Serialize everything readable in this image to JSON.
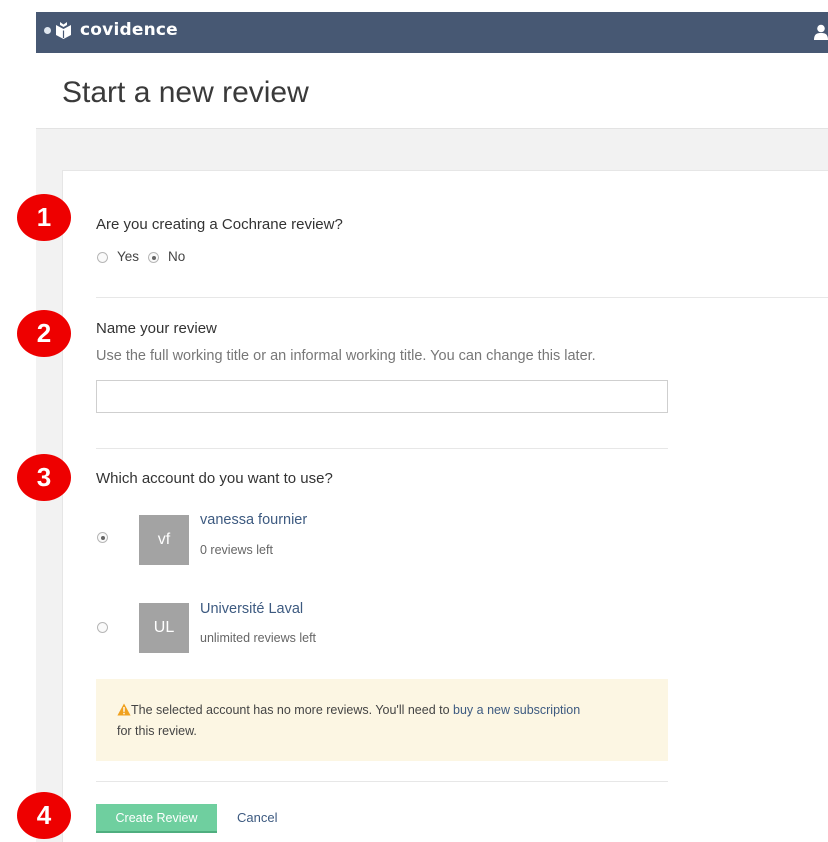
{
  "app": {
    "brand": "covidence",
    "page_title": "Start a new review"
  },
  "steps": [
    "1",
    "2",
    "3",
    "4"
  ],
  "cochrane": {
    "question": "Are you creating a Cochrane review?",
    "yes_label": "Yes",
    "no_label": "No",
    "selected": "No"
  },
  "review_name": {
    "label": "Name your review",
    "hint": "Use the full working title or an informal working title. You can change this later.",
    "value": ""
  },
  "account": {
    "question": "Which account do you want to use?",
    "options": [
      {
        "initials": "vf",
        "name": "vanessa fournier",
        "reviews_left": "0 reviews left",
        "selected": true
      },
      {
        "initials": "UL",
        "name": "Université Laval",
        "reviews_left": "unlimited reviews left",
        "selected": false
      }
    ]
  },
  "warning": {
    "text_before": "The selected account has no more reviews. You'll need to ",
    "link_text": "buy a new subscription",
    "text_after": "for this review."
  },
  "actions": {
    "create_label": "Create Review",
    "cancel_label": "Cancel"
  },
  "colors": {
    "topbar": "#475873",
    "step_badge": "#ee0000",
    "create_button": "#6fcf9f",
    "link": "#3d5a80",
    "warning_bg": "#fcf6e3"
  }
}
